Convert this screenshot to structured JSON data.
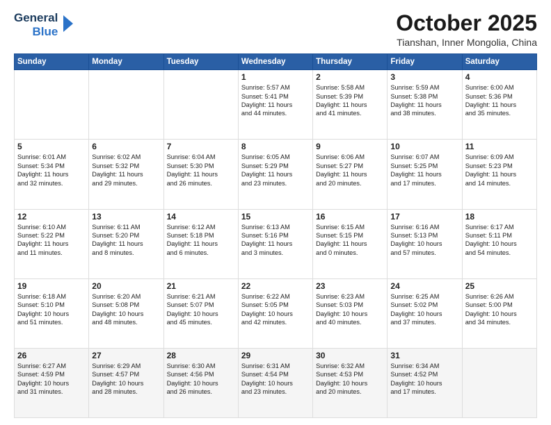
{
  "header": {
    "logo_line1": "General",
    "logo_line2": "Blue",
    "title": "October 2025",
    "subtitle": "Tianshan, Inner Mongolia, China"
  },
  "days_of_week": [
    "Sunday",
    "Monday",
    "Tuesday",
    "Wednesday",
    "Thursday",
    "Friday",
    "Saturday"
  ],
  "weeks": [
    [
      {
        "day": "",
        "text": ""
      },
      {
        "day": "",
        "text": ""
      },
      {
        "day": "",
        "text": ""
      },
      {
        "day": "1",
        "text": "Sunrise: 5:57 AM\nSunset: 5:41 PM\nDaylight: 11 hours\nand 44 minutes."
      },
      {
        "day": "2",
        "text": "Sunrise: 5:58 AM\nSunset: 5:39 PM\nDaylight: 11 hours\nand 41 minutes."
      },
      {
        "day": "3",
        "text": "Sunrise: 5:59 AM\nSunset: 5:38 PM\nDaylight: 11 hours\nand 38 minutes."
      },
      {
        "day": "4",
        "text": "Sunrise: 6:00 AM\nSunset: 5:36 PM\nDaylight: 11 hours\nand 35 minutes."
      }
    ],
    [
      {
        "day": "5",
        "text": "Sunrise: 6:01 AM\nSunset: 5:34 PM\nDaylight: 11 hours\nand 32 minutes."
      },
      {
        "day": "6",
        "text": "Sunrise: 6:02 AM\nSunset: 5:32 PM\nDaylight: 11 hours\nand 29 minutes."
      },
      {
        "day": "7",
        "text": "Sunrise: 6:04 AM\nSunset: 5:30 PM\nDaylight: 11 hours\nand 26 minutes."
      },
      {
        "day": "8",
        "text": "Sunrise: 6:05 AM\nSunset: 5:29 PM\nDaylight: 11 hours\nand 23 minutes."
      },
      {
        "day": "9",
        "text": "Sunrise: 6:06 AM\nSunset: 5:27 PM\nDaylight: 11 hours\nand 20 minutes."
      },
      {
        "day": "10",
        "text": "Sunrise: 6:07 AM\nSunset: 5:25 PM\nDaylight: 11 hours\nand 17 minutes."
      },
      {
        "day": "11",
        "text": "Sunrise: 6:09 AM\nSunset: 5:23 PM\nDaylight: 11 hours\nand 14 minutes."
      }
    ],
    [
      {
        "day": "12",
        "text": "Sunrise: 6:10 AM\nSunset: 5:22 PM\nDaylight: 11 hours\nand 11 minutes."
      },
      {
        "day": "13",
        "text": "Sunrise: 6:11 AM\nSunset: 5:20 PM\nDaylight: 11 hours\nand 8 minutes."
      },
      {
        "day": "14",
        "text": "Sunrise: 6:12 AM\nSunset: 5:18 PM\nDaylight: 11 hours\nand 6 minutes."
      },
      {
        "day": "15",
        "text": "Sunrise: 6:13 AM\nSunset: 5:16 PM\nDaylight: 11 hours\nand 3 minutes."
      },
      {
        "day": "16",
        "text": "Sunrise: 6:15 AM\nSunset: 5:15 PM\nDaylight: 11 hours\nand 0 minutes."
      },
      {
        "day": "17",
        "text": "Sunrise: 6:16 AM\nSunset: 5:13 PM\nDaylight: 10 hours\nand 57 minutes."
      },
      {
        "day": "18",
        "text": "Sunrise: 6:17 AM\nSunset: 5:11 PM\nDaylight: 10 hours\nand 54 minutes."
      }
    ],
    [
      {
        "day": "19",
        "text": "Sunrise: 6:18 AM\nSunset: 5:10 PM\nDaylight: 10 hours\nand 51 minutes."
      },
      {
        "day": "20",
        "text": "Sunrise: 6:20 AM\nSunset: 5:08 PM\nDaylight: 10 hours\nand 48 minutes."
      },
      {
        "day": "21",
        "text": "Sunrise: 6:21 AM\nSunset: 5:07 PM\nDaylight: 10 hours\nand 45 minutes."
      },
      {
        "day": "22",
        "text": "Sunrise: 6:22 AM\nSunset: 5:05 PM\nDaylight: 10 hours\nand 42 minutes."
      },
      {
        "day": "23",
        "text": "Sunrise: 6:23 AM\nSunset: 5:03 PM\nDaylight: 10 hours\nand 40 minutes."
      },
      {
        "day": "24",
        "text": "Sunrise: 6:25 AM\nSunset: 5:02 PM\nDaylight: 10 hours\nand 37 minutes."
      },
      {
        "day": "25",
        "text": "Sunrise: 6:26 AM\nSunset: 5:00 PM\nDaylight: 10 hours\nand 34 minutes."
      }
    ],
    [
      {
        "day": "26",
        "text": "Sunrise: 6:27 AM\nSunset: 4:59 PM\nDaylight: 10 hours\nand 31 minutes."
      },
      {
        "day": "27",
        "text": "Sunrise: 6:29 AM\nSunset: 4:57 PM\nDaylight: 10 hours\nand 28 minutes."
      },
      {
        "day": "28",
        "text": "Sunrise: 6:30 AM\nSunset: 4:56 PM\nDaylight: 10 hours\nand 26 minutes."
      },
      {
        "day": "29",
        "text": "Sunrise: 6:31 AM\nSunset: 4:54 PM\nDaylight: 10 hours\nand 23 minutes."
      },
      {
        "day": "30",
        "text": "Sunrise: 6:32 AM\nSunset: 4:53 PM\nDaylight: 10 hours\nand 20 minutes."
      },
      {
        "day": "31",
        "text": "Sunrise: 6:34 AM\nSunset: 4:52 PM\nDaylight: 10 hours\nand 17 minutes."
      },
      {
        "day": "",
        "text": ""
      }
    ]
  ]
}
